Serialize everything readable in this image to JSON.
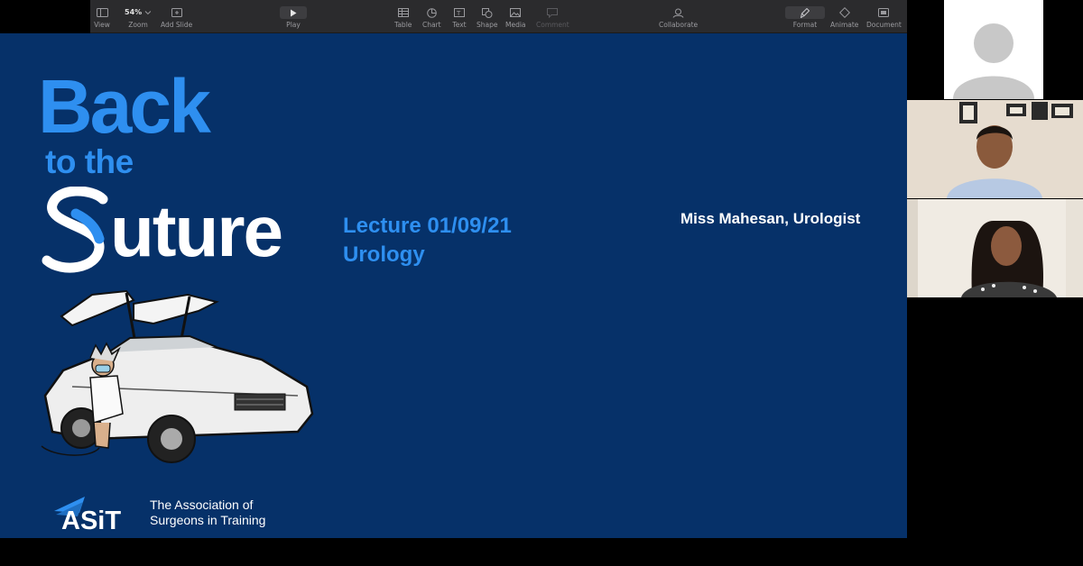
{
  "toolbar": {
    "view": "View",
    "zoom_value": "54%",
    "zoom": "Zoom",
    "add_slide": "Add Slide",
    "play": "Play",
    "table": "Table",
    "chart": "Chart",
    "text": "Text",
    "shape": "Shape",
    "media": "Media",
    "comment": "Comment",
    "collaborate": "Collaborate",
    "format": "Format",
    "animate": "Animate",
    "document": "Document"
  },
  "slide": {
    "back": "Back",
    "to_the": "to the",
    "uture": "uture",
    "lecture_line": "Lecture  01/09/21",
    "subject": "Urology",
    "presenter": "Miss Mahesan, Urologist",
    "asit_logo_text": "ASiT",
    "asit_line1": "The Association of",
    "asit_line2": "Surgeons in Training"
  },
  "colors": {
    "slide_bg": "#063169",
    "accent_blue": "#2e8ff0",
    "toolbar_bg": "#2b2b2d"
  }
}
